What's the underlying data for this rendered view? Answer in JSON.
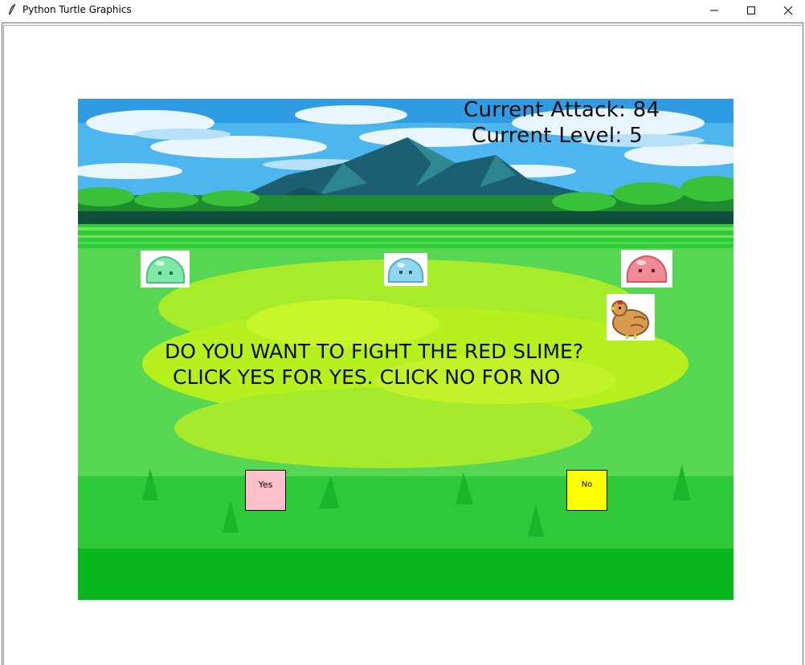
{
  "window": {
    "title": "Python Turtle Graphics",
    "icon": "feather-icon",
    "controls": [
      "minimize-icon",
      "maximize-icon",
      "close-icon"
    ]
  },
  "hud": {
    "attack": "Current Attack: 84",
    "level": "Current Level: 5"
  },
  "prompt": {
    "line1": "DO YOU WANT TO FIGHT THE RED SLIME?",
    "line2": "CLICK YES FOR YES. CLICK NO FOR NO"
  },
  "buttons": {
    "yes": {
      "label": "Yes",
      "color": "#ffc0cb"
    },
    "no": {
      "label": "No",
      "color": "#ffff00"
    }
  },
  "sprites": [
    {
      "name": "green-slime",
      "color": "#7ee8a6"
    },
    {
      "name": "blue-slime",
      "color": "#8fd6ee"
    },
    {
      "name": "red-slime",
      "color": "#f08a94"
    },
    {
      "name": "chicken-player",
      "color": "#d99a52"
    }
  ],
  "colors": {
    "sky": "#4fb8f0",
    "mountain": "#1f6f78",
    "grass": "#3fd23f",
    "grass_light": "#b8f01e"
  }
}
